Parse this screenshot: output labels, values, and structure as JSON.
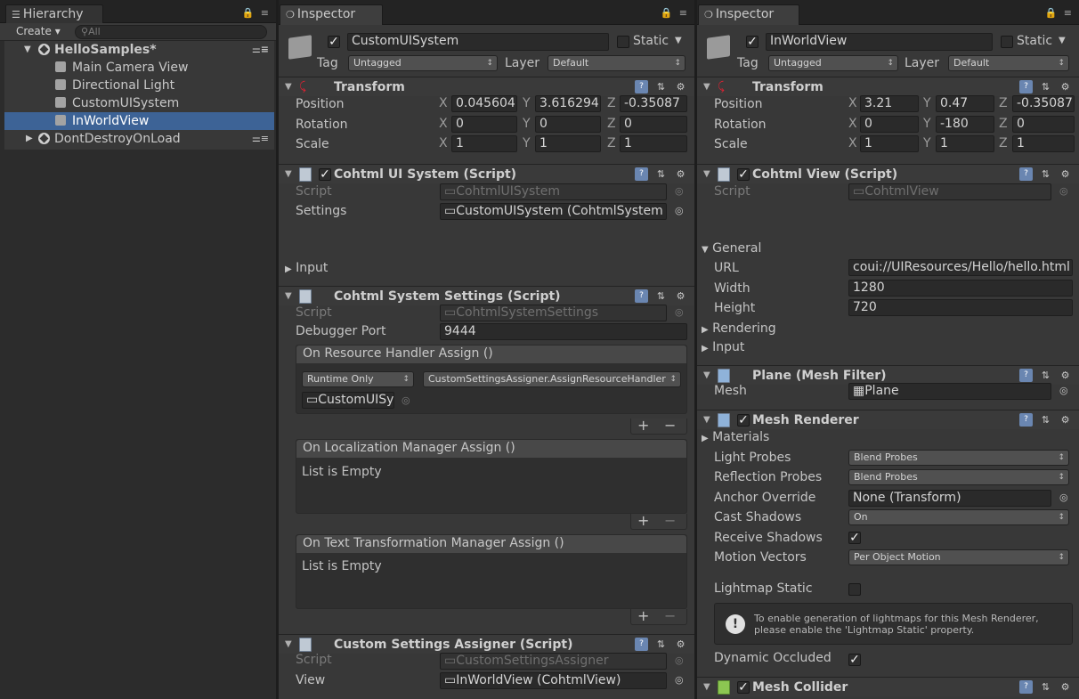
{
  "hierarchy": {
    "tab": "Hierarchy",
    "create": "Create",
    "search_placeholder": "All",
    "scene": "HelloSamples*",
    "items": [
      "Main Camera View",
      "Directional Light",
      "CustomUISystem",
      "InWorldView"
    ],
    "ddol": "DontDestroyOnLoad"
  },
  "left": {
    "tab": "Inspector",
    "object_name": "CustomUISystem",
    "static_label": "Static",
    "tag_label": "Tag",
    "tag_value": "Untagged",
    "layer_label": "Layer",
    "layer_value": "Default",
    "transform": {
      "title": "Transform",
      "position": "Position",
      "rotation": "Rotation",
      "scale": "Scale",
      "pos": [
        "0.045604",
        "3.616294",
        "-0.35087"
      ],
      "rot": [
        "0",
        "0",
        "0"
      ],
      "scl": [
        "1",
        "1",
        "1"
      ]
    },
    "uisystem": {
      "title": "Cohtml UI System (Script)",
      "script_label": "Script",
      "script_value": "CohtmlUISystem",
      "settings_label": "Settings",
      "settings_value": "CustomUISystem (CohtmlSystem",
      "input_label": "Input"
    },
    "syssettings": {
      "title": "Cohtml System Settings (Script)",
      "script_label": "Script",
      "script_value": "CohtmlSystemSettings",
      "port_label": "Debugger Port",
      "port_value": "9444",
      "ev1_title": "On Resource Handler Assign ()",
      "ev1_mode": "Runtime Only",
      "ev1_func": "CustomSettingsAssigner.AssignResourceHandler",
      "ev1_obj": "CustomUISy",
      "ev2_title": "On Localization Manager Assign ()",
      "ev2_empty": "List is Empty",
      "ev3_title": "On Text Transformation Manager Assign ()",
      "ev3_empty": "List is Empty"
    },
    "assigner": {
      "title": "Custom Settings Assigner (Script)",
      "script_label": "Script",
      "script_value": "CustomSettingsAssigner",
      "view_label": "View",
      "view_value": "InWorldView (CohtmlView)"
    }
  },
  "right": {
    "tab": "Inspector",
    "object_name": "InWorldView",
    "static_label": "Static",
    "tag_label": "Tag",
    "tag_value": "Untagged",
    "layer_label": "Layer",
    "layer_value": "Default",
    "transform": {
      "title": "Transform",
      "position": "Position",
      "rotation": "Rotation",
      "scale": "Scale",
      "pos": [
        "3.21",
        "0.47",
        "-0.35087"
      ],
      "rot": [
        "0",
        "-180",
        "0"
      ],
      "scl": [
        "1",
        "1",
        "1"
      ]
    },
    "view": {
      "title": "Cohtml View (Script)",
      "script_label": "Script",
      "script_value": "CohtmlView",
      "general": "General",
      "url_label": "URL",
      "url_value": "coui://UIResources/Hello/hello.html",
      "width_label": "Width",
      "width_value": "1280",
      "height_label": "Height",
      "height_value": "720",
      "rendering": "Rendering",
      "input": "Input"
    },
    "meshfilter": {
      "title": "Plane (Mesh Filter)",
      "mesh_label": "Mesh",
      "mesh_value": "Plane"
    },
    "meshrenderer": {
      "title": "Mesh Renderer",
      "materials": "Materials",
      "light_probes_label": "Light Probes",
      "light_probes_value": "Blend Probes",
      "refl_label": "Reflection Probes",
      "refl_value": "Blend Probes",
      "anchor_label": "Anchor Override",
      "anchor_value": "None (Transform)",
      "cast_label": "Cast Shadows",
      "cast_value": "On",
      "recv_label": "Receive Shadows",
      "motion_label": "Motion Vectors",
      "motion_value": "Per Object Motion",
      "lightmap_label": "Lightmap Static",
      "help": "To enable generation of lightmaps for this Mesh Renderer, please enable the 'Lightmap Static' property.",
      "occl_label": "Dynamic Occluded"
    },
    "collider": {
      "title": "Mesh Collider"
    }
  },
  "axes": [
    "X",
    "Y",
    "Z"
  ]
}
